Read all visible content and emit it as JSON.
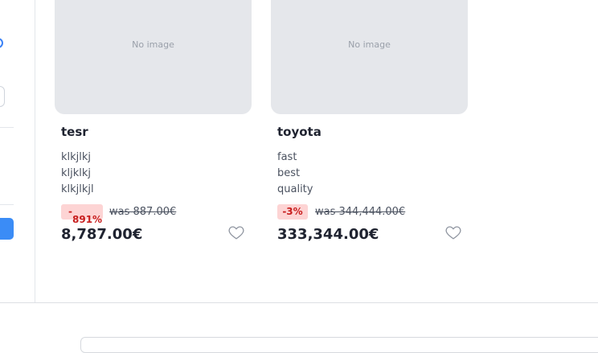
{
  "products": [
    {
      "image_placeholder": "No image",
      "title": "tesr",
      "description": [
        "klkjlkj",
        "kljklkj",
        "klkjlkjl"
      ],
      "discount_line1": "-",
      "discount_line2": "891%",
      "was_price": "was 887.00€",
      "price": "8,787.00€"
    },
    {
      "image_placeholder": "No image",
      "title": "toyota",
      "description": [
        "fast",
        "best",
        "quality"
      ],
      "discount": "-3%",
      "was_price": "was 344,444.00€",
      "price": "333,344.00€"
    }
  ],
  "icons": {
    "favorite": "heart-outline-icon"
  },
  "colors": {
    "accent": "#3b8cf6",
    "discount_bg": "#fdd4d4",
    "discount_text": "#c81e1e",
    "placeholder_bg": "#e5e7eb"
  }
}
